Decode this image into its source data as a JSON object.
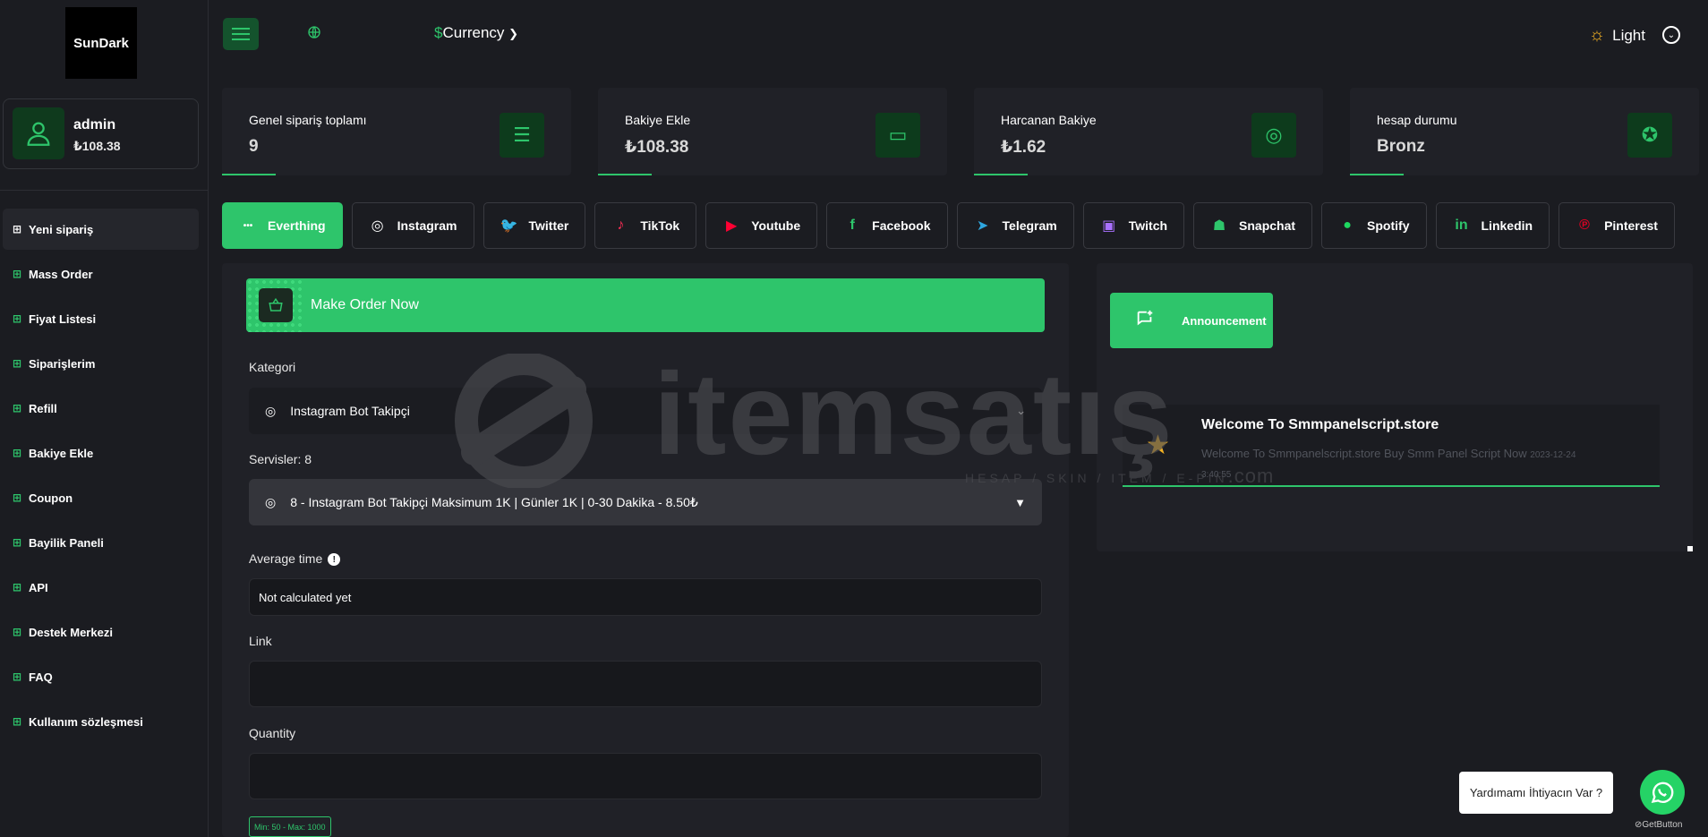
{
  "brand": {
    "logo_text": "SunDark"
  },
  "user": {
    "name": "admin",
    "balance": "₺108.38"
  },
  "menu": [
    {
      "label": "Yeni sipariş",
      "icon": "plus-square-icon",
      "active": true
    },
    {
      "label": "Mass Order",
      "icon": "plus-square-icon"
    },
    {
      "label": "Fiyat Listesi",
      "icon": "grid-icon"
    },
    {
      "label": "Siparişlerim",
      "icon": "list-icon"
    },
    {
      "label": "Refill",
      "icon": "recycle-icon"
    },
    {
      "label": "Bakiye Ekle",
      "icon": "wallet-icon"
    },
    {
      "label": "Coupon",
      "icon": "coupon-icon"
    },
    {
      "label": "Bayilik Paneli",
      "icon": "store-icon"
    },
    {
      "label": "API",
      "icon": "api-icon"
    },
    {
      "label": "Destek Merkezi",
      "icon": "headset-icon"
    },
    {
      "label": "FAQ",
      "icon": "faq-icon"
    },
    {
      "label": "Kullanım sözleşmesi",
      "icon": "document-icon"
    }
  ],
  "topbar": {
    "currency_symbol": "$",
    "currency_label": "Currency",
    "theme_label": "Light"
  },
  "stats": [
    {
      "label": "Genel sipariş toplamı",
      "value": "9",
      "icon": "orders-icon"
    },
    {
      "label": "Bakiye Ekle",
      "value": "₺108.38",
      "icon": "wallet-icon"
    },
    {
      "label": "Harcanan Bakiye",
      "value": "₺1.62",
      "icon": "coins-icon"
    },
    {
      "label": "hesap durumu",
      "value": "Bronz",
      "icon": "medal-icon"
    }
  ],
  "tabs": [
    {
      "label": "Everthing",
      "icon": "dots-icon",
      "active": true
    },
    {
      "label": "Instagram",
      "icon": "instagram-icon",
      "glyph": "◎",
      "color": "#ffffff"
    },
    {
      "label": "Twitter",
      "icon": "twitter-icon",
      "glyph": "🐦",
      "color": "#1d9bf0"
    },
    {
      "label": "TikTok",
      "icon": "tiktok-icon",
      "glyph": "♪",
      "color": "#ff2d55"
    },
    {
      "label": "Youtube",
      "icon": "youtube-icon",
      "glyph": "▶",
      "color": "#ff0033"
    },
    {
      "label": "Facebook",
      "icon": "facebook-icon",
      "glyph": "f",
      "color": "#2ec56b"
    },
    {
      "label": "Telegram",
      "icon": "telegram-icon",
      "glyph": "➤",
      "color": "#2ea6df"
    },
    {
      "label": "Twitch",
      "icon": "twitch-icon",
      "glyph": "▣",
      "color": "#a970ff"
    },
    {
      "label": "Snapchat",
      "icon": "snapchat-icon",
      "glyph": "☗",
      "color": "#2ec56b"
    },
    {
      "label": "Spotify",
      "icon": "spotify-icon",
      "glyph": "●",
      "color": "#1ed760"
    },
    {
      "label": "Linkedin",
      "icon": "linkedin-icon",
      "glyph": "in",
      "color": "#2ec56b"
    },
    {
      "label": "Pinterest",
      "icon": "pinterest-icon",
      "glyph": "℗",
      "color": "#e60023"
    }
  ],
  "order": {
    "header": "Make Order Now",
    "category_label": "Kategori",
    "category_value": "Instagram Bot Takipçi",
    "services_label": "Servisler: 8",
    "service_value": "8 - Instagram Bot Takipçi Maksimum 1K | Günler 1K | 0-30 Dakika - 8.50₺",
    "avg_time_label": "Average time",
    "avg_time_value": "Not calculated yet",
    "link_label": "Link",
    "quantity_label": "Quantity",
    "minmax": "Min: 50 - Max: 1000"
  },
  "announcement": {
    "button_label": "Announcement",
    "title": "Welcome To Smmpanelscript.store",
    "body": "Welcome To Smmpanelscript.store Buy Smm Panel Script Now",
    "date": "2023-12-24",
    "time": "3:40:55"
  },
  "watermark": {
    "text": "itemsatış",
    "sub": "HESAP / SKIN / ITEM / E-PIN",
    "domain": ".com"
  },
  "help": {
    "bubble": "Yardımamı İhtiyacın Var ?",
    "getbutton": "GetButton"
  },
  "colors": {
    "accent": "#2ec56b",
    "background": "#1b1c21",
    "panel": "#202127"
  }
}
